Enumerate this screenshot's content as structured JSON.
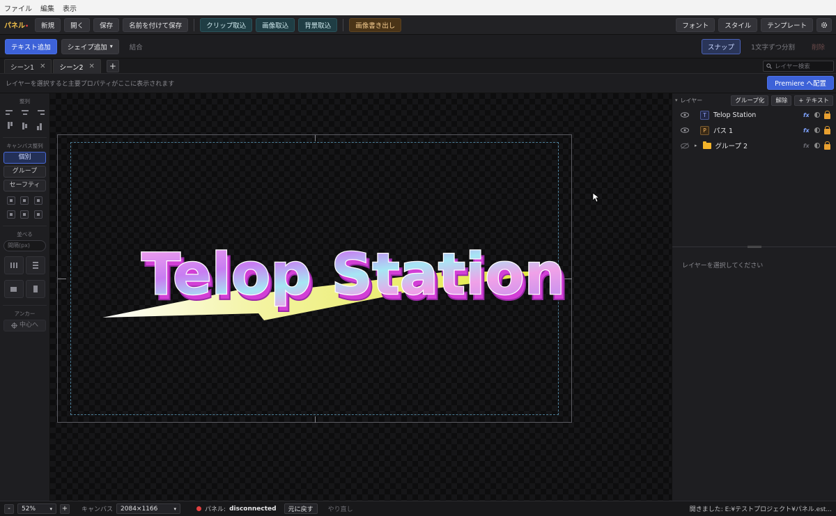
{
  "menu": {
    "items": [
      "ファイル",
      "編集",
      "表示"
    ]
  },
  "toolbar": {
    "brand": "パネル",
    "brand_marker": "•",
    "new_label": "新規",
    "open_label": "開く",
    "save_label": "保存",
    "save_as_label": "名前を付けて保存",
    "clip_import_label": "クリップ取込",
    "image_import_label": "画像取込",
    "bg_import_label": "背景取込",
    "image_export_label": "画像書き出し",
    "font_label": "フォント",
    "style_label": "スタイル",
    "template_label": "テンプレート",
    "settings_icon": "gear-icon"
  },
  "toolbar2": {
    "add_text_label": "テキスト追加",
    "add_shape_label": "シェイプ追加",
    "add_shape_caret": "▾",
    "combine_label": "結合",
    "snap_label": "スナップ",
    "split_chars_label": "1文字ずつ分割",
    "delete_label": "削除"
  },
  "tabs": [
    {
      "label": "シーン1",
      "active": false
    },
    {
      "label": "シーン2",
      "active": true
    }
  ],
  "tab_add_label": "+",
  "layer_search": {
    "placeholder": "レイヤー検索"
  },
  "infobar": {
    "hint": "レイヤーを選択すると主要プロパティがここに表示されます",
    "premiere_label": "Premiere へ配置"
  },
  "left_panel": {
    "align_title": "整列",
    "canvas_align_title": "キャンバス整列",
    "individual_label": "個別",
    "group_label": "グループ",
    "safety_label": "セーフティ",
    "arrange_title": "並べる",
    "spacing_placeholder": "間隔(px)",
    "anchor_title": "アンカー",
    "center_label": "中心へ"
  },
  "canvas": {
    "text": "Telop Station",
    "colors": {
      "pink": "#f59be8",
      "purple": "#b46cf0",
      "cyan": "#9fe4f2",
      "extrude": "#d23fd6",
      "bolt": "#e4e93a"
    }
  },
  "layers": {
    "title": "レイヤー",
    "group_label": "グループ化",
    "ungroup_label": "解除",
    "add_text_label": "+ テキスト",
    "fx_label": "fx",
    "items": [
      {
        "name": "Telop Station",
        "type": "T",
        "visible": true
      },
      {
        "name": "パス 1",
        "type": "P",
        "visible": true
      },
      {
        "name": "グループ 2",
        "type": "group",
        "visible": false
      }
    ],
    "empty_props": "レイヤーを選択してください"
  },
  "statusbar": {
    "zoom_minus": "-",
    "zoom_value": "52%",
    "zoom_plus": "+",
    "canvas_label": "キャンバス",
    "canvas_size": "2084×1166",
    "panel_label": "パネル:",
    "panel_status": "disconnected",
    "undo_label": "元に戻す",
    "redo_label": "やり直し",
    "path_text": "開きました: E:¥テストプロジェクト¥パネル.est..."
  }
}
